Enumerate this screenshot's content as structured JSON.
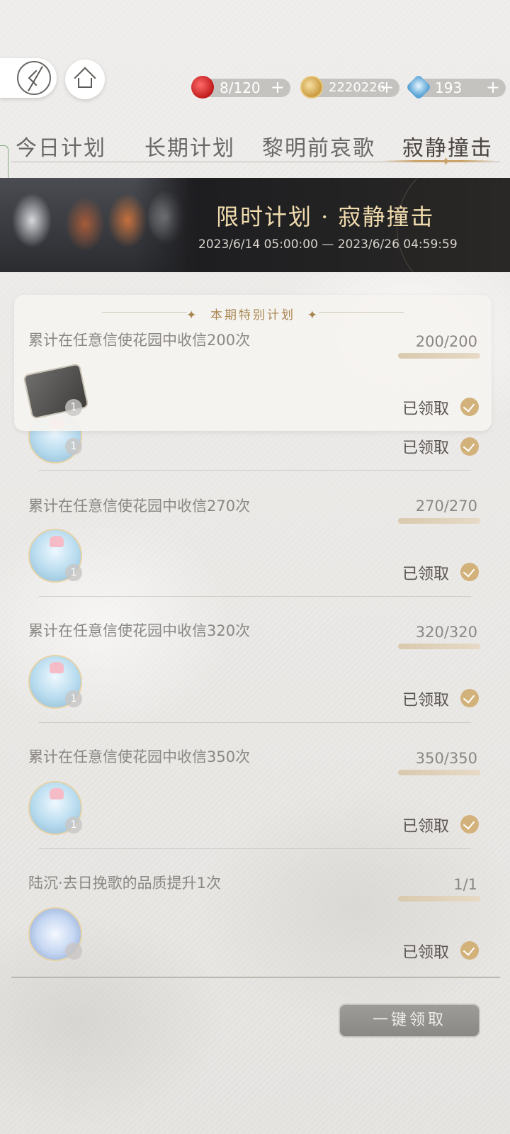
{
  "resources": [
    {
      "icon": "apple-icon",
      "value": "8/120"
    },
    {
      "icon": "gold-coin-icon",
      "value": "2220226"
    },
    {
      "icon": "diamond-icon",
      "value": "193"
    }
  ],
  "tabs": [
    {
      "label": "今日计划",
      "active": false
    },
    {
      "label": "长期计划",
      "active": false
    },
    {
      "label": "黎明前哀歌",
      "active": false
    },
    {
      "label": "寂静撞击",
      "active": true
    }
  ],
  "banner": {
    "title": "限时计划 · 寂静撞击",
    "date_range": "2023/6/14 05:00:00 — 2023/6/26 04:59:59"
  },
  "special": {
    "heading": "本期特别计划",
    "task": "累计在任意信使花园中收信200次",
    "progress": "200/200",
    "reward_qty": "1",
    "status": "已领取"
  },
  "tasks": [
    {
      "task": "",
      "progress": "",
      "reward_qty": "1",
      "status": "已领取"
    },
    {
      "task": "累计在任意信使花园中收信270次",
      "progress": "270/270",
      "reward_qty": "1",
      "status": "已领取"
    },
    {
      "task": "累计在任意信使花园中收信320次",
      "progress": "320/320",
      "reward_qty": "1",
      "status": "已领取"
    },
    {
      "task": "累计在任意信使花园中收信350次",
      "progress": "350/350",
      "reward_qty": "1",
      "status": "已领取"
    },
    {
      "task": "陆沉·去日挽歌的品质提升1次",
      "progress": "1/1",
      "reward_qty": "",
      "status": "已领取"
    }
  ],
  "claim_all_label": "一键领取"
}
